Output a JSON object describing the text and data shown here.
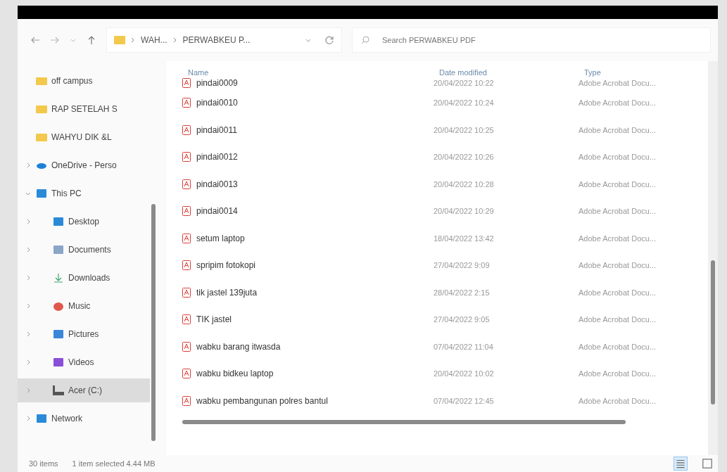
{
  "toolbar": {
    "breadcrumb": [
      "WAH...",
      "PERWABKEU P..."
    ],
    "search": {
      "placeholder": "Search PERWABKEU PDF"
    }
  },
  "sidebar": {
    "items": [
      {
        "label": "off campus",
        "kind": "folder",
        "selected": false
      },
      {
        "label": "RAP SETELAH S",
        "kind": "folder",
        "selected": false
      },
      {
        "label": "WAHYU DIK &L",
        "kind": "folder",
        "selected": false
      },
      {
        "label": "OneDrive - Perso",
        "kind": "cloud",
        "selected": false,
        "expanded": false
      },
      {
        "label": "This PC",
        "kind": "pc",
        "selected": false,
        "expanded": true,
        "children": [
          {
            "label": "Desktop",
            "kind": "desktop",
            "selected": false,
            "expanded": false
          },
          {
            "label": "Documents",
            "kind": "documents",
            "selected": false,
            "expanded": false
          },
          {
            "label": "Downloads",
            "kind": "downloads",
            "selected": false,
            "expanded": false
          },
          {
            "label": "Music",
            "kind": "music",
            "selected": false,
            "expanded": false
          },
          {
            "label": "Pictures",
            "kind": "pictures",
            "selected": false,
            "expanded": false
          },
          {
            "label": "Videos",
            "kind": "videos",
            "selected": false,
            "expanded": false
          },
          {
            "label": "Acer (C:)",
            "kind": "drive",
            "selected": true,
            "expanded": false
          }
        ]
      },
      {
        "label": "Network",
        "kind": "network",
        "selected": false,
        "expanded": false
      }
    ]
  },
  "table": {
    "columns": [
      "Name",
      "Date modified",
      "Type"
    ],
    "rows": [
      {
        "name": "pindai0009",
        "date": "20/04/2022 10:22",
        "type": "Adobe Acrobat Docu...",
        "selected": false
      },
      {
        "name": "pindai0010",
        "date": "20/04/2022 10:24",
        "type": "Adobe Acrobat Docu...",
        "selected": false
      },
      {
        "name": "pindai0011",
        "date": "20/04/2022 10:25",
        "type": "Adobe Acrobat Docu...",
        "selected": false
      },
      {
        "name": "pindai0012",
        "date": "20/04/2022 10:26",
        "type": "Adobe Acrobat Docu...",
        "selected": false
      },
      {
        "name": "pindai0013",
        "date": "20/04/2022 10:28",
        "type": "Adobe Acrobat Docu...",
        "selected": false
      },
      {
        "name": "pindai0014",
        "date": "20/04/2022 10:29",
        "type": "Adobe Acrobat Docu...",
        "selected": false
      },
      {
        "name": "setum laptop",
        "date": "18/04/2022 13:42",
        "type": "Adobe Acrobat Docu...",
        "selected": false
      },
      {
        "name": "spripim fotokopi",
        "date": "27/04/2022 9:09",
        "type": "Adobe Acrobat Docu...",
        "selected": false
      },
      {
        "name": "tik jastel 139juta",
        "date": "28/04/2022 2:15",
        "type": "Adobe Acrobat Docu...",
        "selected": false
      },
      {
        "name": "TIK jastel",
        "date": "27/04/2022 9:05",
        "type": "Adobe Acrobat Docu...",
        "selected": false
      },
      {
        "name": "wabku barang itwasda",
        "date": "07/04/2022 11:04",
        "type": "Adobe Acrobat Docu...",
        "selected": false
      },
      {
        "name": "wabku bidkeu laptop",
        "date": "20/04/2022 10:02",
        "type": "Adobe Acrobat Docu...",
        "selected": false
      },
      {
        "name": "wabku pembangunan polres bantul",
        "date": "07/04/2022 12:45",
        "type": "Adobe Acrobat Docu...",
        "selected": false
      }
    ]
  },
  "status_bar": {
    "count": "30 items",
    "selection": "1 item selected  4.44 MB"
  },
  "view_buttons": [
    {
      "kind": "details",
      "selected": true
    },
    {
      "kind": "tiles",
      "selected": false
    }
  ]
}
